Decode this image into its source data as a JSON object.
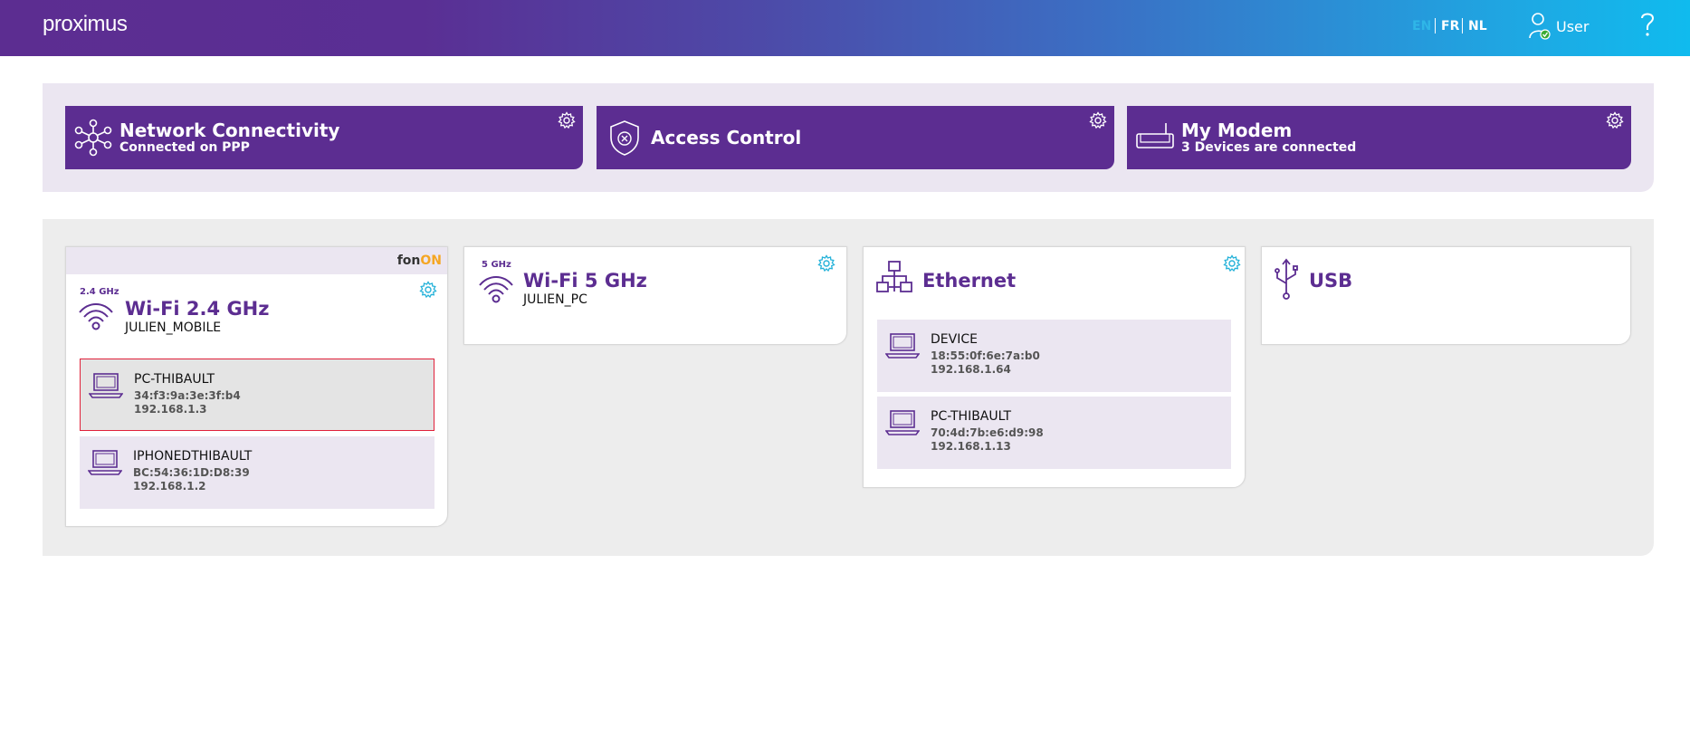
{
  "header": {
    "logo": "proximus",
    "languages": [
      {
        "code": "EN",
        "active": true
      },
      {
        "code": "FR",
        "active": false
      },
      {
        "code": "NL",
        "active": false
      }
    ],
    "user_label": "User",
    "colors": {
      "brand_purple": "#5c2d91",
      "brand_blue": "#10bbee",
      "active_lang": "#2fb6e8"
    }
  },
  "summary_tiles": [
    {
      "title": "Network Connectivity",
      "subtitle": "Connected on PPP",
      "icon": "network-hub-icon"
    },
    {
      "title": "Access Control",
      "subtitle": "",
      "icon": "shield-icon"
    },
    {
      "title": "My Modem",
      "subtitle": "3 Devices are connected",
      "icon": "modem-icon"
    }
  ],
  "cards": {
    "wifi24": {
      "badge": "fon",
      "badge_on": "ON",
      "freq": "2.4 GHz",
      "title": "Wi-Fi 2.4 GHz",
      "ssid": "JULIEN_MOBILE",
      "devices": [
        {
          "name": "PC-THIBAULT",
          "mac": "34:f3:9a:3e:3f:b4",
          "ip": "192.168.1.3",
          "selected": true
        },
        {
          "name": "IPHONEDTHIBAULT",
          "mac": "BC:54:36:1D:D8:39",
          "ip": "192.168.1.2",
          "selected": false
        }
      ]
    },
    "wifi5": {
      "freq": "5 GHz",
      "title": "Wi-Fi 5 GHz",
      "ssid": "JULIEN_PC"
    },
    "ethernet": {
      "title": "Ethernet",
      "devices": [
        {
          "name": "DEVICE",
          "mac": "18:55:0f:6e:7a:b0",
          "ip": "192.168.1.64"
        },
        {
          "name": "PC-THIBAULT",
          "mac": "70:4d:7b:e6:d9:98",
          "ip": "192.168.1.13"
        }
      ]
    },
    "usb": {
      "title": "USB"
    }
  }
}
